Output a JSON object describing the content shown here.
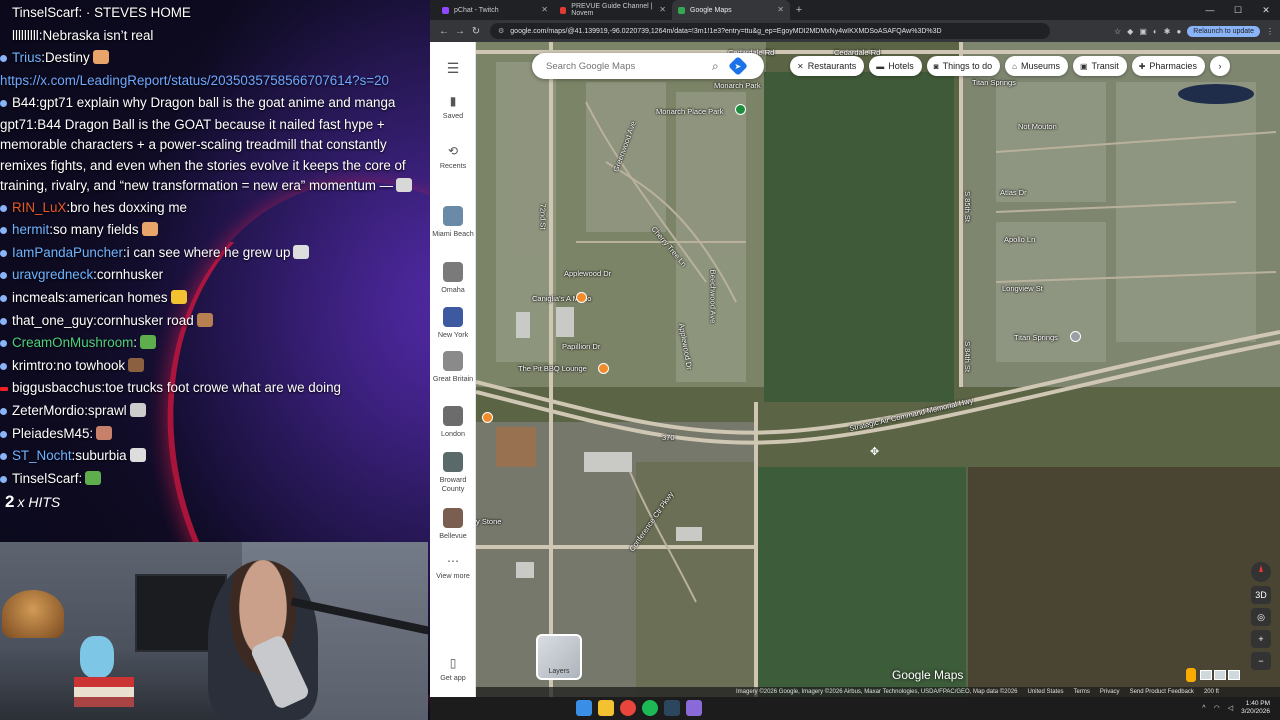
{
  "chat": {
    "messages": [
      {
        "user": "TinselScarf",
        "text": ": · STEVES HOME",
        "color": "#ffffff"
      },
      {
        "user": "lllllllll",
        "text": ":Nebraska isn’t real",
        "color": "#ffffff"
      },
      {
        "user": "Trius",
        "text": ":Destiny",
        "color": "#ffffff"
      },
      {
        "user": "",
        "text": "https://x.com/LeadingReport/status/2035035758566707614?s=20",
        "color": "#ffffff"
      },
      {
        "user": "B44",
        "text": ":gpt71 explain why Dragon ball is the goat anime and manga",
        "color": "#ffffff"
      },
      {
        "user": "gpt71",
        "text": ":B44 Dragon Ball is the GOAT because it nailed fast hype + memorable characters + a power-scaling treadmill that constantly remixes fights, and even when the stories evolve it keeps the core of training, rivalry, and “new transformation = new era” momentum —",
        "color": "#ffffff"
      },
      {
        "user": "RIN_LuX",
        "text": ":bro hes doxxing me",
        "color": "#e85a2a"
      },
      {
        "user": "hermit",
        "text": ":so many fields",
        "color": "#6eb4ff"
      },
      {
        "user": "IamPandaPuncher",
        "text": ":i can see where he grew up",
        "color": "#6eb4ff"
      },
      {
        "user": "uravgredneck",
        "text": ":cornhusker",
        "color": "#6eb4ff"
      },
      {
        "user": "incmeals",
        "text": ":american homes",
        "color": "#ffffff"
      },
      {
        "user": "that_one_guy",
        "text": ":cornhusker road",
        "color": "#ffffff"
      },
      {
        "user": "CreamOnMushroom",
        "text": ":",
        "color": "#4fd07a"
      },
      {
        "user": "krimtro",
        "text": ":no towhook",
        "color": "#ffffff"
      },
      {
        "user": "biggusbacchus",
        "text": ":toe trucks foot crowe what are we doing",
        "color": "#ffffff"
      },
      {
        "user": "ZeterMordio",
        "text": ":sprawl",
        "color": "#ffffff"
      },
      {
        "user": "PleiadesM45",
        "text": ":",
        "color": "#ffffff"
      },
      {
        "user": "ST_Nocht",
        "text": ":suburbia",
        "color": "#6eb4ff"
      },
      {
        "user": "TinselScarf",
        "text": ":",
        "color": "#ffffff"
      }
    ],
    "hits_count": "2",
    "hits_label": "x HITS"
  },
  "browser": {
    "tabs": [
      {
        "title": "pChat - Twitch",
        "color": "#9146ff",
        "active": false
      },
      {
        "title": "PREVUE Guide Channel | Novem",
        "color": "#e53935",
        "active": false
      },
      {
        "title": "Google Maps",
        "color": "#34a853",
        "active": true
      }
    ],
    "url": "google.com/maps/@41.139919,-96.0220739,1264m/data=!3m1!1e3?entry=ttu&g_ep=EgoyMDI2MDMxNy4wIKXMDSoASAFQAw%3D%3D",
    "relaunch_label": "Relaunch to update"
  },
  "maps": {
    "search_placeholder": "Search Google Maps",
    "chips": [
      "Restaurants",
      "Hotels",
      "Things to do",
      "Museums",
      "Transit",
      "Pharmacies"
    ],
    "rail": [
      {
        "label": "Saved",
        "icon": "bookmark-icon"
      },
      {
        "label": "Recents",
        "icon": "history-icon"
      },
      {
        "label": "Miami Beach",
        "icon": "place-thumb"
      },
      {
        "label": "Omaha",
        "icon": "place-thumb"
      },
      {
        "label": "New York",
        "icon": "place-thumb"
      },
      {
        "label": "Great Britain",
        "icon": "place-thumb"
      },
      {
        "label": "London",
        "icon": "place-thumb"
      },
      {
        "label": "Broward County",
        "icon": "place-thumb"
      },
      {
        "label": "Bellevue",
        "icon": "place-thumb"
      },
      {
        "label": "View more",
        "icon": "more-icon"
      },
      {
        "label": "Get app",
        "icon": "phone-icon"
      }
    ],
    "labels": {
      "monarch_place_park": "Monarch Place Park",
      "monarch_park": "Monarch Park",
      "cedardale_rd_1": "Cedardale Rd",
      "cedardale_rd_2": "Cedardale Rd",
      "applewood_dr": "Applewood Dr",
      "papillion_dr": "Papillion Dr",
      "the_pit": "The Pit BBQ Lounge",
      "carmichael": "Caniglia's A Mano",
      "strategic": "Strategic Air Command Memorial Hwy",
      "atlas_dr": "Atlas Dr",
      "apollo_ln": "Apollo Ln",
      "longview_st": "Longview St",
      "titan_springs": "Titan Springs",
      "titan_springs_top": "Titan Springs",
      "s_84th": "S 84th St",
      "s_85th": "S 85th St",
      "not_mouton": "Not Mouton",
      "cherry_tree": "Cherry Tree Ln",
      "greenwood": "Greenwood Ave",
      "beechwood": "Beechwood Ave",
      "applewood_d": "Applewood Dr",
      "n72nd": "72nd St",
      "conference": "Conference Ctr Pkwy",
      "applewood_ct": "Applewood Ct",
      "hwy_370": "370",
      "stone": "y Stone"
    },
    "layers_label": "Layers",
    "logo": "Google Maps",
    "attribution": [
      "Imagery ©2026 Google, Imagery ©2026 Airbus, Maxar Technologies, USDA/FPAC/GEO, Map data ©2026",
      "United States",
      "Terms",
      "Privacy",
      "Send Product Feedback",
      "200 ft"
    ],
    "controls": [
      "3D"
    ]
  },
  "taskbar": {
    "time": "1:40 PM",
    "date": "3/20/2026"
  }
}
